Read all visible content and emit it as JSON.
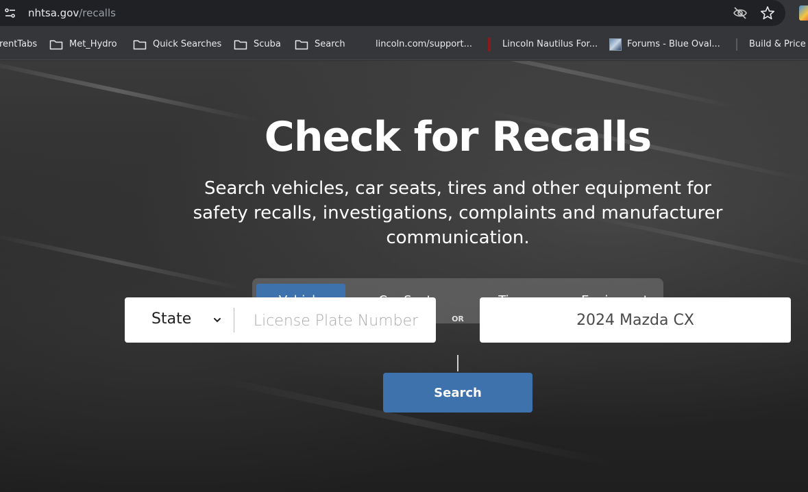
{
  "browser": {
    "url_host": "nhtsa.gov",
    "url_path": "/recalls",
    "icons": [
      "site-info-icon",
      "eye-off-icon",
      "star-icon",
      "extension-icon"
    ],
    "bookmarks": [
      {
        "label": "rentTabs",
        "icon": "none"
      },
      {
        "label": "Met_Hydro",
        "icon": "folder-icon"
      },
      {
        "label": "Quick Searches",
        "icon": "folder-icon"
      },
      {
        "label": "Scuba",
        "icon": "folder-icon"
      },
      {
        "label": "Search",
        "icon": "folder-icon"
      },
      {
        "label": "lincoln.com/support...",
        "icon": "favicon-icon"
      },
      {
        "label": "Lincoln Nautilus For...",
        "icon": "favicon-icon"
      },
      {
        "label": "Forums - Blue Oval...",
        "icon": "favicon-icon"
      },
      {
        "label": "Build & Price",
        "icon": "favicon-icon"
      }
    ]
  },
  "hero": {
    "title": "Check for Recalls",
    "subtitle_lines": [
      "Search vehicles, car seats, tires and other equipment for",
      "safety recalls, investigations, complaints and manufacturer",
      "communication."
    ]
  },
  "tabs": {
    "items": [
      {
        "label": "Vehicle",
        "active": true
      },
      {
        "label": "Car Seat",
        "active": false
      },
      {
        "label": "Tire",
        "active": false
      },
      {
        "label": "Equipment",
        "active": false
      }
    ]
  },
  "search": {
    "state_label": "State",
    "plate_placeholder": "License Plate Number",
    "or_label": "OR",
    "vehicle_value": "2024 Mazda CX",
    "button_label": "Search"
  },
  "colors": {
    "accent": "#3d72ad",
    "chrome_bg": "#35363a",
    "url_bg": "#202124"
  }
}
